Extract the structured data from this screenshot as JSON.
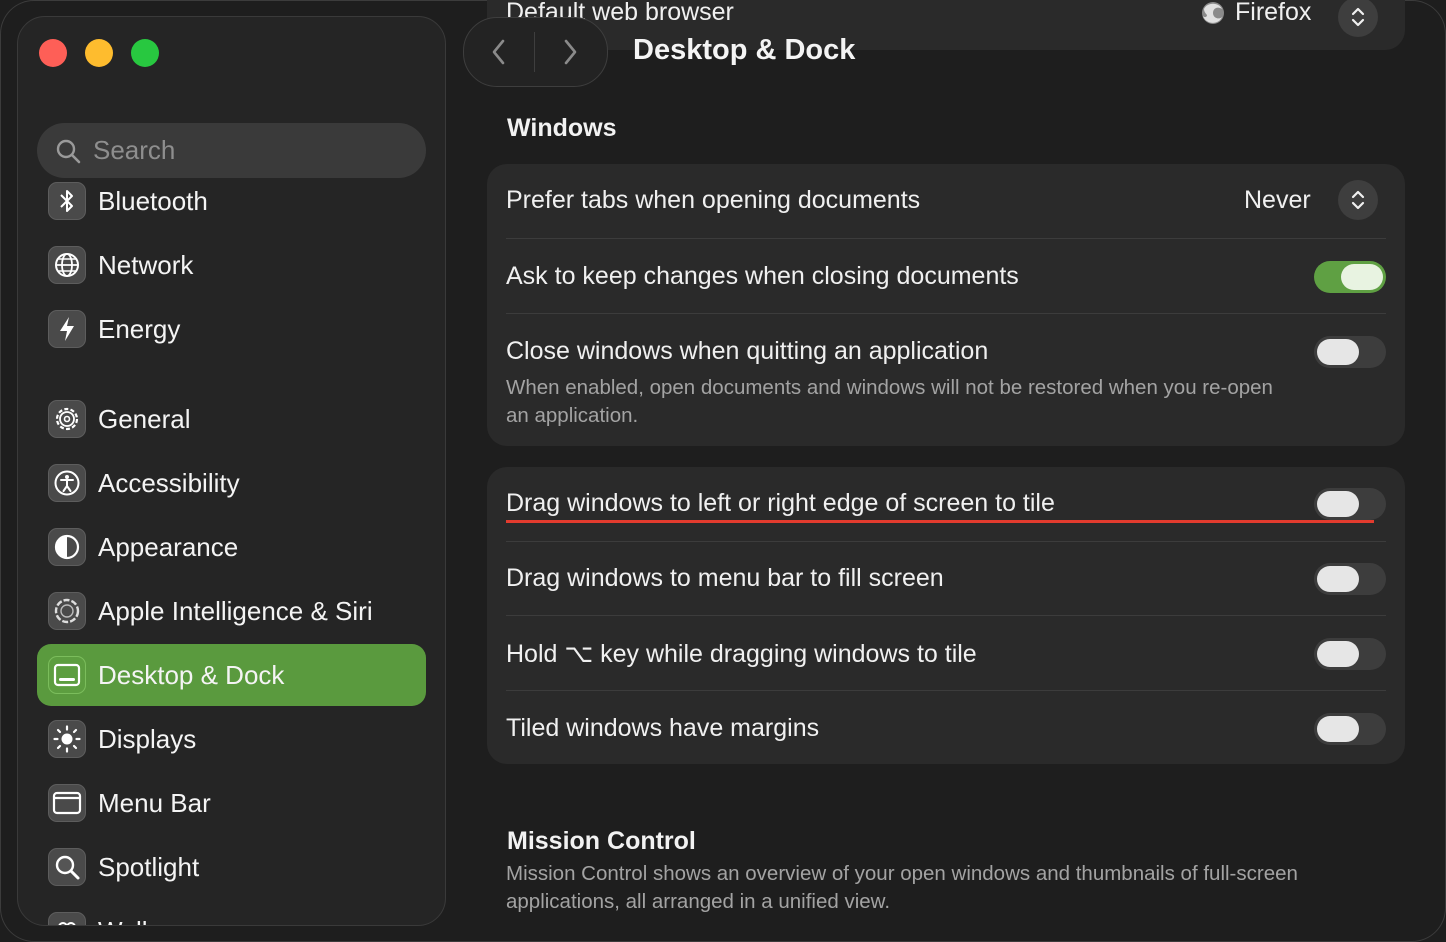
{
  "window": {
    "title": "Desktop & Dock"
  },
  "search": {
    "placeholder": "Search"
  },
  "sidebar": {
    "items": [
      {
        "label": "Bluetooth",
        "icon": "bluetooth-icon"
      },
      {
        "label": "Network",
        "icon": "globe-icon"
      },
      {
        "label": "Energy",
        "icon": "lightning-icon"
      },
      {
        "label": "General",
        "icon": "gear-icon"
      },
      {
        "label": "Accessibility",
        "icon": "accessibility-icon"
      },
      {
        "label": "Appearance",
        "icon": "appearance-icon"
      },
      {
        "label": "Apple Intelligence & Siri",
        "icon": "apple-intelligence-icon"
      },
      {
        "label": "Desktop & Dock",
        "icon": "desktop-dock-icon",
        "selected": true
      },
      {
        "label": "Displays",
        "icon": "brightness-icon"
      },
      {
        "label": "Menu Bar",
        "icon": "menu-bar-icon"
      },
      {
        "label": "Spotlight",
        "icon": "magnifier-icon"
      },
      {
        "label": "Wallpaper",
        "icon": "wallpaper-icon"
      }
    ]
  },
  "top_setting": {
    "label": "Default web browser",
    "value": "Firefox",
    "value_icon": "firefox-icon"
  },
  "windows_section": {
    "title": "Windows",
    "prefer_tabs": {
      "label": "Prefer tabs when opening documents",
      "value": "Never"
    },
    "ask_keep_changes": {
      "label": "Ask to keep changes when closing documents",
      "on": true
    },
    "close_windows": {
      "label": "Close windows when quitting an application",
      "description": "When enabled, open documents and windows will not be restored when you re-open an application.",
      "on": false
    }
  },
  "tiling_section": {
    "drag_edge": {
      "label": "Drag windows to left or right edge of screen to tile",
      "on": false
    },
    "drag_menu_bar": {
      "label": "Drag windows to menu bar to fill screen",
      "on": false
    },
    "hold_option": {
      "label": "Hold ⌥ key while dragging windows to tile",
      "on": false
    },
    "tiled_margins": {
      "label": "Tiled windows have margins",
      "on": false
    }
  },
  "mission_control": {
    "title": "Mission Control",
    "description": "Mission Control shows an overview of your open windows and thumbnails of full-screen applications, all arranged in a unified view."
  },
  "colors": {
    "accent": "#5a9a3e",
    "annotation_underline": "#e33b2e"
  }
}
